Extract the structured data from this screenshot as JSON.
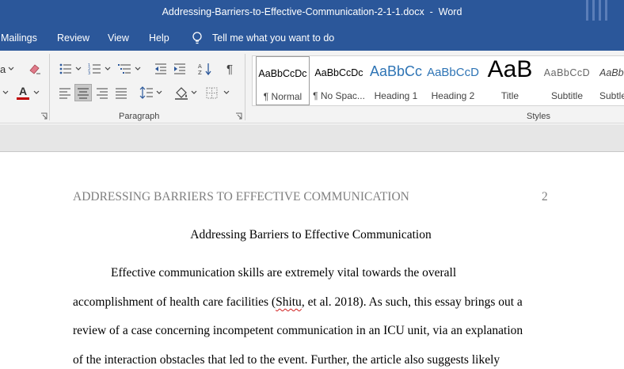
{
  "window": {
    "title": "Addressing-Barriers-to-Effective-Communication-2-1-1.docx  -  Word"
  },
  "menu": {
    "tabs": [
      "Mailings",
      "Review",
      "View",
      "Help"
    ],
    "tell_me": "Tell me what you want to do"
  },
  "ribbon": {
    "partial_font_label": "a",
    "paragraph_label": "Paragraph",
    "styles_label": "Styles",
    "font_color": "#c00000",
    "styles": [
      {
        "preview": "AaBbCcDc",
        "label": "¶ Normal"
      },
      {
        "preview": "AaBbCcDc",
        "label": "¶ No Spac..."
      },
      {
        "preview": "AaBbCc",
        "label": "Heading 1"
      },
      {
        "preview": "AaBbCcD",
        "label": "Heading 2"
      },
      {
        "preview": "AaB",
        "label": "Title"
      },
      {
        "preview": "AaBbCcD",
        "label": "Subtitle"
      },
      {
        "preview": "AaBbC",
        "label": "Subtle"
      }
    ]
  },
  "document": {
    "running_head": "ADDRESSING BARRIERS TO EFFECTIVE COMMUNICATION",
    "page_number": "2",
    "title": "Addressing Barriers to Effective Communication",
    "line1": "Effective communication skills are extremely vital towards the overall",
    "line2_before": "accomplishment of health care facilities (",
    "line2_cite": "Shitu",
    "line2_after": ", et al. 2018). As such, this essay brings out a",
    "line3": "review of a case concerning incompetent communication in an ICU unit, via an explanation",
    "line4": "of the interaction obstacles that led to the event. Further, the article also suggests likely"
  }
}
